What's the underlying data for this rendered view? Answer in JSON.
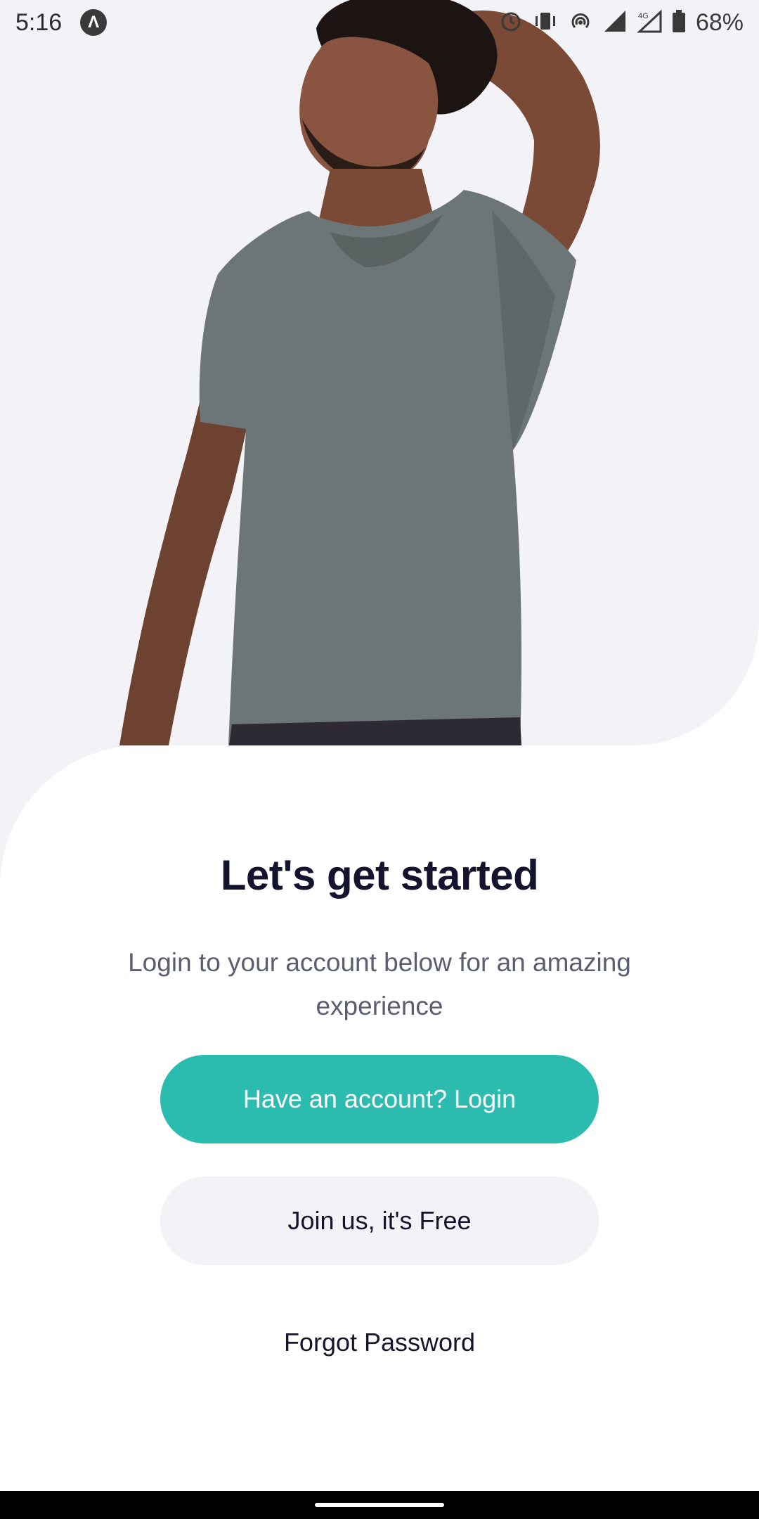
{
  "status_bar": {
    "time": "5:16",
    "app_badge": "Λ",
    "battery": "68%",
    "network": "4G",
    "icons": [
      "alarm-icon",
      "vibrate-icon",
      "hotspot-icon",
      "signal-icon",
      "battery-icon"
    ]
  },
  "hero": {
    "image_description_icon": "hero-photo"
  },
  "content": {
    "title": "Let's get started",
    "subtitle": "Login to your account below for an amazing experience"
  },
  "buttons": {
    "login_label": "Have an account? Login",
    "join_label": "Join us, it's Free",
    "forgot_label": "Forgot Password"
  },
  "colors": {
    "accent": "#2bbcaf",
    "title": "#14142e",
    "subtitle": "#5b5e70",
    "secondary_button": "#f3f2f6",
    "hero_background": "#f3f2f6"
  }
}
